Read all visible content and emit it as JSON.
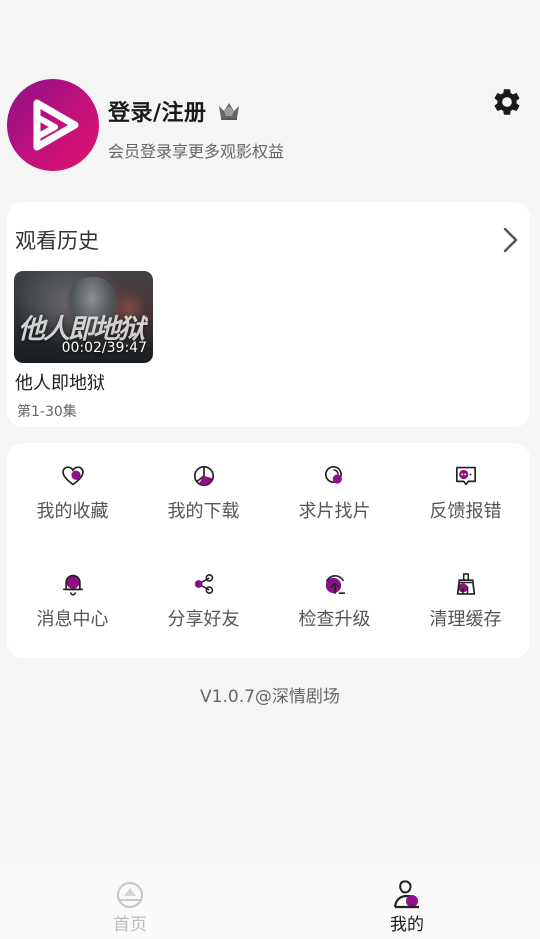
{
  "profile": {
    "title": "登录/注册",
    "subtitle": "会员登录享更多观影权益"
  },
  "history": {
    "title": "观看历史",
    "item": {
      "overlay_title": "他人即地狱",
      "time": "00:02/39:47",
      "name": "他人即地狱",
      "episodes": "第1-30集"
    }
  },
  "menu": [
    {
      "label": "我的收藏",
      "icon": "heart-icon"
    },
    {
      "label": "我的下载",
      "icon": "download-icon"
    },
    {
      "label": "求片找片",
      "icon": "search-film-icon"
    },
    {
      "label": "反馈报错",
      "icon": "feedback-icon"
    },
    {
      "label": "消息中心",
      "icon": "bell-icon"
    },
    {
      "label": "分享好友",
      "icon": "share-icon"
    },
    {
      "label": "检查升级",
      "icon": "upgrade-icon"
    },
    {
      "label": "清理缓存",
      "icon": "broom-icon"
    }
  ],
  "version": "V1.0.7@深情剧场",
  "nav": {
    "home": "首页",
    "mine": "我的"
  },
  "colors": {
    "accent": "#8e0f88",
    "accent_pink": "#e0146a",
    "background": "#f5f5f5",
    "card": "#ffffff"
  }
}
